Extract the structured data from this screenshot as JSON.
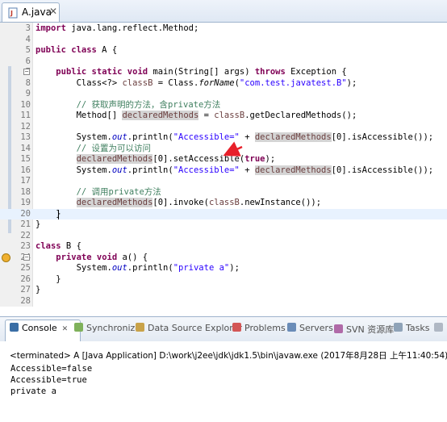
{
  "editor_tab": {
    "label": "A.java",
    "close": "✕",
    "icon": "java-file-icon"
  },
  "lines": [
    {
      "n": "3",
      "hl": false,
      "html": "<span class=\"kw\">import</span> java.lang.reflect.Method;"
    },
    {
      "n": "4",
      "hl": false,
      "html": ""
    },
    {
      "n": "5",
      "hl": false,
      "html": "<span class=\"kw\">public class</span> A {"
    },
    {
      "n": "6",
      "hl": false,
      "html": ""
    },
    {
      "n": "7",
      "hl": false,
      "fold": true,
      "html": "    <span class=\"kw\">public static void</span> main(String[] args) <span class=\"kw\">throws</span> Exception {"
    },
    {
      "n": "8",
      "hl": false,
      "html": "        Class&lt;?&gt; <span class=\"loc\">classB</span> = Class.<span class=\"it\">forName</span>(<span class=\"str\">\"com.test.javatest.B\"</span>);"
    },
    {
      "n": "9",
      "hl": false,
      "html": ""
    },
    {
      "n": "10",
      "hl": false,
      "html": "        <span class=\"cm\">// 获取声明的方法，含private方法</span>"
    },
    {
      "n": "11",
      "hl": false,
      "html": "        Method[] <span class=\"locu\">declaredMethods</span> = <span class=\"loc\">classB</span>.getDeclaredMethods();"
    },
    {
      "n": "12",
      "hl": false,
      "html": ""
    },
    {
      "n": "13",
      "hl": false,
      "html": "        System.<span class=\"fi\">out</span>.println(<span class=\"str\">\"Accessible=\"</span> + <span class=\"locu\">declaredMethods</span>[0].isAccessible());"
    },
    {
      "n": "14",
      "hl": false,
      "html": "        <span class=\"cm\">// 设置为可以访问</span>"
    },
    {
      "n": "15",
      "hl": false,
      "html": "        <span class=\"locu\">declaredMethods</span>[0].setAccessible(<span class=\"kw\">true</span>);"
    },
    {
      "n": "16",
      "hl": false,
      "html": "        System.<span class=\"fi\">out</span>.println(<span class=\"str\">\"Accessible=\"</span> + <span class=\"locu\">declaredMethods</span>[0].isAccessible());"
    },
    {
      "n": "17",
      "hl": false,
      "html": ""
    },
    {
      "n": "18",
      "hl": false,
      "html": "        <span class=\"cm\">// 调用private方法</span>"
    },
    {
      "n": "19",
      "hl": false,
      "html": "        <span class=\"locu\">declaredMethods</span>[0].invoke(<span class=\"loc\">classB</span>.newInstance());"
    },
    {
      "n": "20",
      "hl": true,
      "html": "    }"
    },
    {
      "n": "21",
      "hl": false,
      "html": "}"
    },
    {
      "n": "22",
      "hl": false,
      "html": ""
    },
    {
      "n": "23",
      "hl": false,
      "html": "<span class=\"kw\">class</span> B {"
    },
    {
      "n": "24",
      "hl": false,
      "fold": true,
      "marker": true,
      "html": "    <span class=\"kw\">private void</span> a() {"
    },
    {
      "n": "25",
      "hl": false,
      "html": "        System.<span class=\"fi\">out</span>.println(<span class=\"str\">\"private a\"</span>);"
    },
    {
      "n": "26",
      "hl": false,
      "html": "    }"
    },
    {
      "n": "27",
      "hl": false,
      "html": "}"
    },
    {
      "n": "28",
      "hl": false,
      "html": ""
    }
  ],
  "views": {
    "console": "Console",
    "synchronize": "Synchronize",
    "data_source_explorer": "Data Source Explorer",
    "problems": "Problems",
    "servers": "Servers",
    "svn": "SVN 资源库",
    "tasks": "Tasks"
  },
  "console": {
    "terminated": "<terminated> A [Java Application] D:\\work\\j2ee\\jdk\\jdk1.5\\bin\\javaw.exe (2017年8月28日 上午11:40:54)",
    "output": [
      "Accessible=false",
      "Accessible=true",
      "private a"
    ]
  },
  "colors": {
    "keyword": "#7f0055",
    "string": "#2a00ff",
    "comment": "#3f7f5f",
    "arrow": "#e8202a"
  }
}
